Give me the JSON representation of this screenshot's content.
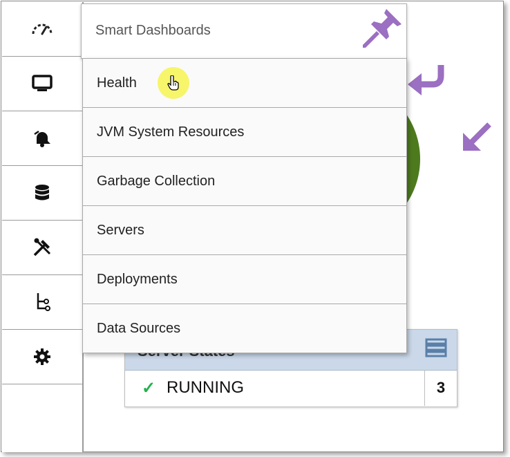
{
  "sidebar": {
    "items": [
      {
        "icon": "gauge-icon",
        "name": "sidebar-item-dashboards"
      },
      {
        "icon": "monitor-icon",
        "name": "sidebar-item-monitoring"
      },
      {
        "icon": "bell-icon",
        "name": "sidebar-item-alerts"
      },
      {
        "icon": "database-icon",
        "name": "sidebar-item-datasources"
      },
      {
        "icon": "tools-icon",
        "name": "sidebar-item-tools"
      },
      {
        "icon": "hierarchy-icon",
        "name": "sidebar-item-tree"
      },
      {
        "icon": "gear-icon",
        "name": "sidebar-item-settings"
      }
    ]
  },
  "menu": {
    "title": "Smart Dashboards",
    "items": [
      "Health",
      "JVM System Resources",
      "Garbage Collection",
      "Servers",
      "Deployments",
      "Data Sources"
    ]
  },
  "status_panel": {
    "title": "Server States",
    "row_label": "RUNNING",
    "row_count": "3"
  },
  "colors": {
    "annotation_purple": "#9b6fc1",
    "donut_green": "#4e7a1e",
    "check_green": "#22b14c",
    "header_blue": "#cad8ea"
  }
}
